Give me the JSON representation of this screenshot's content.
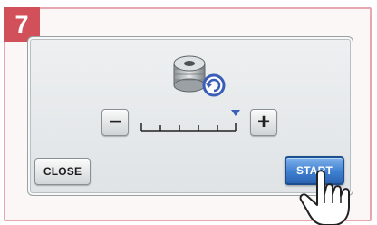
{
  "step": {
    "number": "7"
  },
  "panel": {
    "icon": "bobbin-winding-icon",
    "speed_control": {
      "minus_label": "−",
      "plus_label": "+",
      "level": 1.0,
      "tick_count": 6
    },
    "close_label": "CLOSE",
    "start_label": "START"
  },
  "colors": {
    "step_badge": "#d2505a",
    "frame_border": "#e8a7ae",
    "start_button": "#3f7fd0",
    "indicator": "#3a5db8"
  },
  "pointer": {
    "icon": "pointing-hand-icon"
  }
}
